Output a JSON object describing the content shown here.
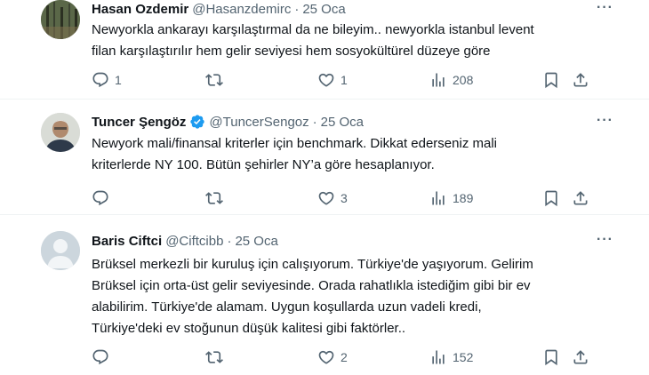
{
  "tweets": [
    {
      "name": "Hasan Ozdemir",
      "handle": "@Hasanzdemirc",
      "dot": "·",
      "date": "25 Oca",
      "more": "···",
      "text": "Newyorkla ankarayı karşılaştırmal da ne bileyim.. newyorkla istanbul levent\nfilan karşılaştırılır hem gelir seviyesi hem sosyokültürel düzeye göre",
      "reply_count": "1",
      "retweet_count": "",
      "like_count": "1",
      "view_count": "208",
      "verified": false
    },
    {
      "name": "Tuncer Şengöz",
      "handle": "@TuncerSengoz",
      "dot": "·",
      "date": "25 Oca",
      "more": "···",
      "text": "Newyork mali/finansal kriterler için benchmark. Dikkat ederseniz mali\nkriterlerde NY 100. Bütün şehirler NY’a göre hesaplanıyor.",
      "reply_count": "",
      "retweet_count": "",
      "like_count": "3",
      "view_count": "189",
      "verified": true
    },
    {
      "name": "Baris Ciftci",
      "handle": "@Ciftcibb",
      "dot": "·",
      "date": "25 Oca",
      "more": "···",
      "text": "Brüksel merkezli bir kuruluş için calışıyorum. Türkiye'de yaşıyorum. Gelirim\nBrüksel için orta-üst gelir seviyesinde. Orada rahatlıkla istediğim gibi bir ev\nalabilirim. Türkiye'de alamam. Uygun koşullarda uzun vadeli kredi,\nTürkiye'deki ev stoğunun düşük kalitesi gibi faktörler..",
      "reply_count": "",
      "retweet_count": "",
      "like_count": "2",
      "view_count": "152",
      "verified": false
    }
  ],
  "colors": {
    "text": "#0f1419",
    "secondary": "#536471",
    "verified": "#1d9bf0",
    "divider": "#eff3f4"
  },
  "icons": [
    "reply-icon",
    "retweet-icon",
    "like-icon",
    "views-icon",
    "bookmark-icon",
    "share-icon",
    "verified-badge-icon",
    "more-icon"
  ]
}
